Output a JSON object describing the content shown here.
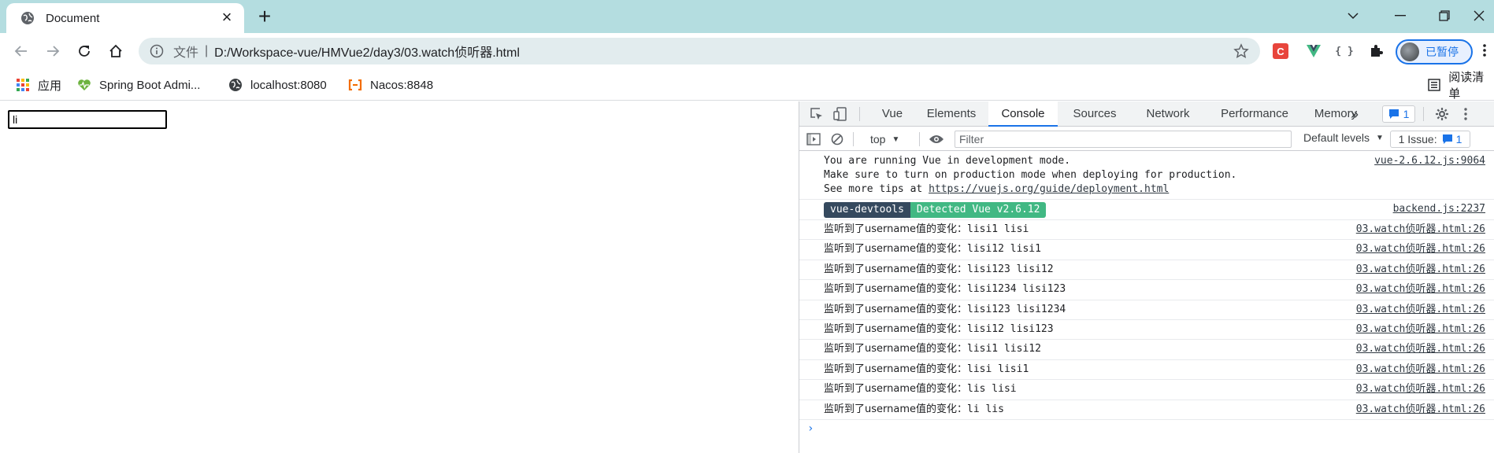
{
  "tab": {
    "title": "Document",
    "favicon": "globe-icon"
  },
  "window": {
    "controls": [
      "chevron-down-icon",
      "minimize-icon",
      "restore-icon",
      "close-icon"
    ]
  },
  "omnibox": {
    "scheme_label": "文件",
    "separator": "|",
    "url": "D:/Workspace-vue/HMVue2/day3/03.watch侦听器.html"
  },
  "extensions": {
    "c_label": "C",
    "v_label": "V",
    "json_label": "{ }"
  },
  "profile": {
    "label": "已暂停"
  },
  "bookmarks": [
    {
      "label": "应用",
      "icon": "apps-grid-icon"
    },
    {
      "label": "Spring Boot Admi...",
      "icon": "heartbeat-icon"
    },
    {
      "label": "localhost:8080",
      "icon": "globe-icon"
    },
    {
      "label": "Nacos:8848",
      "icon": "nacos-icon"
    }
  ],
  "reading_list": {
    "label": "阅读清单"
  },
  "page": {
    "input_value": "li"
  },
  "devtools": {
    "tabs": [
      "Vue",
      "Elements",
      "Console",
      "Sources",
      "Network",
      "Performance",
      "Memory"
    ],
    "active_tab": "Console",
    "more": "»",
    "message_count": "1",
    "context": "top",
    "filter_placeholder": "Filter",
    "levels": "Default levels",
    "issues_label": "1 Issue:",
    "issues_count": "1"
  },
  "console": {
    "intro": {
      "line1": "You are running Vue in development mode.",
      "line2": "Make sure to turn on production mode when deploying for production.",
      "line3_prefix": "See more tips at ",
      "line3_link": "https://vuejs.org/guide/deployment.html",
      "source": "vue-2.6.12.js:9064"
    },
    "devtools_msg": {
      "badge_dark": "vue-devtools",
      "badge_green": "Detected Vue v2.6.12",
      "source": "backend.js:2237"
    },
    "log_prefix": "监听到了username值的变化：",
    "logs": [
      {
        "values": "lisi1 lisi",
        "source": "03.watch侦听器.html:26"
      },
      {
        "values": "lisi12 lisi1",
        "source": "03.watch侦听器.html:26"
      },
      {
        "values": "lisi123 lisi12",
        "source": "03.watch侦听器.html:26"
      },
      {
        "values": "lisi1234 lisi123",
        "source": "03.watch侦听器.html:26"
      },
      {
        "values": "lisi123 lisi1234",
        "source": "03.watch侦听器.html:26"
      },
      {
        "values": "lisi12 lisi123",
        "source": "03.watch侦听器.html:26"
      },
      {
        "values": "lisi1 lisi12",
        "source": "03.watch侦听器.html:26"
      },
      {
        "values": "lisi lisi1",
        "source": "03.watch侦听器.html:26"
      },
      {
        "values": "lis lisi",
        "source": "03.watch侦听器.html:26"
      },
      {
        "values": "li lis",
        "source": "03.watch侦听器.html:26"
      }
    ],
    "prompt": "›"
  },
  "colors": {
    "tabstrip": "#b4dde0",
    "accent": "#1a73e8",
    "vue_green": "#41b883",
    "vue_dark": "#35495e"
  }
}
